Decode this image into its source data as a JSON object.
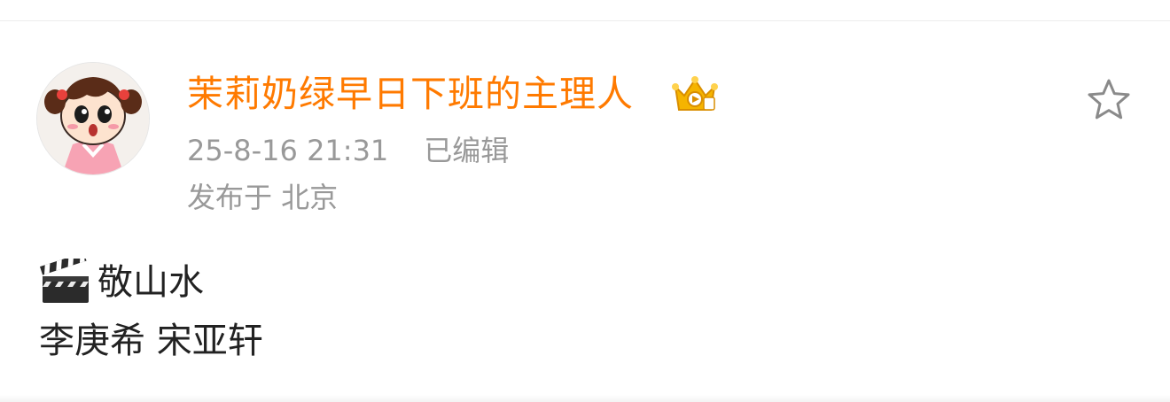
{
  "post": {
    "author": {
      "name": "茉莉奶绿早日下班的主理人",
      "badge_icon": "crown-badge-icon",
      "avatar_icon": "cartoon-girl-avatar"
    },
    "timestamp": "25-8-16 21:31",
    "edited_label": "已编辑",
    "location": "发布于 北京",
    "favorite_icon": "star-outline-icon",
    "content": {
      "line1_icon": "clapper-board-icon",
      "line1_text": "敬山水",
      "line2_text": "李庚希 宋亚轩"
    }
  },
  "colors": {
    "username": "#ff7a00",
    "meta": "#999999",
    "body_text": "#222222",
    "icon_gray": "#8a8a8a"
  }
}
